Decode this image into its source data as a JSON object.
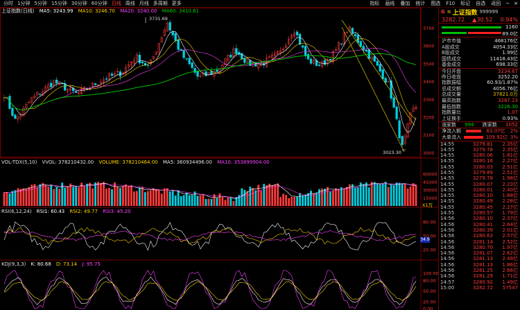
{
  "toolbar": {
    "periods": [
      "分时",
      "1分钟",
      "5分钟",
      "15分钟",
      "30分钟",
      "60分钟",
      "日线",
      "周线",
      "月线",
      "多周期",
      "更多"
    ],
    "active_period": "日线",
    "tools": [
      "指标",
      "画线",
      "叠加",
      "统计",
      "图选",
      "F10",
      "标记",
      "自选",
      "返回"
    ]
  },
  "main_chart": {
    "title": "上证指数(日线)",
    "ma5": "MA5: 3243.99",
    "ma10": "MA10: 3246.70",
    "ma20": "MA20: 3240.00",
    "ma60": "MA60: 3410.61",
    "high_label": "3731.69",
    "low_label": "3023.30",
    "price_axis": [
      "3700",
      "3600",
      "3500",
      "3400",
      "3300",
      "3200",
      "3100",
      "3000"
    ]
  },
  "volume_chart": {
    "title": "VOL-TDX(5,10)",
    "vvol": "VVOL: 378210432.00",
    "volume": "VOLUME: 378210464.00",
    "ma5": "MA5: 360934496.00",
    "ma10": "MA10: 353899904.00",
    "axis": [
      "60000",
      "45000",
      "30000",
      "15000"
    ],
    "unit": "X1万"
  },
  "rsi_chart": {
    "title": "RSI(6,12,24)",
    "rsi1": "RSI1: 60.43",
    "rsi2": "RSI2: 49.77",
    "rsi3": "RSI3: 45.20",
    "axis": [
      "80.00",
      "50.00",
      "20.00"
    ],
    "marker": "34.9"
  },
  "kdj_chart": {
    "title": "KDJ(9,3,3)",
    "k": "K: 80.68",
    "d": "D: 73.14",
    "j": "J: 95.75",
    "axis": [
      "100.00",
      "80.00",
      "50.00",
      "20.00",
      "0.00"
    ]
  },
  "quote": {
    "name": "上证指数",
    "code": "999999",
    "badge": "G",
    "price": "3282.72",
    "change": "▲30.52",
    "change_pct": "0.94%",
    "bar_up": "1160",
    "bar_down": "89.0亿",
    "stats": [
      {
        "label": "沪市市值",
        "value": "468176亿",
        "color": "#e0e0e0"
      },
      {
        "label": "A股成交",
        "value": "4054.33亿",
        "color": "#e0e0e0"
      },
      {
        "label": "B股成交",
        "value": "1.99亿",
        "color": "#e0e0e0"
      },
      {
        "label": "国债成交",
        "value": "11418.43亿",
        "color": "#e0e0e0"
      },
      {
        "label": "基金成交",
        "value": "698.33亿",
        "color": "#e0e0e0"
      },
      {
        "label": "今日开盘",
        "value": "3234.67",
        "color": "#ff3b3b"
      },
      {
        "label": "昨日收盘",
        "value": "3252.20",
        "color": "#e0e0e0"
      },
      {
        "label": "指数振幅",
        "value": "60.93/1.87%",
        "color": "#e0e0e0"
      },
      {
        "label": "总成交额",
        "value": "4056.76亿",
        "color": "#e0e0e0"
      },
      {
        "label": "总成交量",
        "value": "37821.0万",
        "color": "#e8c000"
      },
      {
        "label": "最高指数",
        "value": "3287.23",
        "color": "#ff3b3b"
      },
      {
        "label": "最低指数",
        "value": "3226.30",
        "color": "#00d000"
      },
      {
        "label": "指数量比",
        "value": "1.07",
        "color": "#ff3b3b"
      },
      {
        "label": "上证换手",
        "value": "0.93%",
        "color": "#e0e0e0"
      }
    ],
    "updown": {
      "up_label": "涨家数",
      "up_value": "1052",
      "down_label": "跌家数",
      "down_value": "994"
    },
    "flows": [
      {
        "label": "净流入额",
        "value": "63.07亿",
        "pct": "2%"
      },
      {
        "label": "大单流入",
        "value": "109.92亿",
        "pct": "3%"
      }
    ],
    "ticks": [
      {
        "time": "14:55",
        "price": "3279.81",
        "vol": "2.35亿"
      },
      {
        "time": "14:55",
        "price": "3279.78",
        "vol": "2.35亿"
      },
      {
        "time": "14:55",
        "price": "3280.06",
        "vol": "1.81亿"
      },
      {
        "time": "14:55",
        "price": "3280.16",
        "vol": "2.27亿"
      },
      {
        "time": "14:55",
        "price": "3280.03",
        "vol": "2.51亿"
      },
      {
        "time": "14:55",
        "price": "3279.89",
        "vol": "2.51亿"
      },
      {
        "time": "14:55",
        "price": "3279.78",
        "vol": "1.98亿"
      },
      {
        "time": "14:55",
        "price": "3280.07",
        "vol": "2.23亿"
      },
      {
        "time": "14:55",
        "price": "3280.01",
        "vol": "2.40亿"
      },
      {
        "time": "14:55",
        "price": "3280.10",
        "vol": "1.88亿"
      },
      {
        "time": "14:55",
        "price": "3280.49",
        "vol": "2.28亿"
      },
      {
        "time": "14:55",
        "price": "3280.45",
        "vol": "2.27亿"
      },
      {
        "time": "14:55",
        "price": "3280.57",
        "vol": "1.79亿"
      },
      {
        "time": "14:56",
        "price": "3280.10",
        "vol": "2.37亿"
      },
      {
        "time": "14:56",
        "price": "3280.41",
        "vol": "2.64亿"
      },
      {
        "time": "14:56",
        "price": "3280.39",
        "vol": "2.01亿"
      },
      {
        "time": "14:56",
        "price": "3280.63",
        "vol": "2.57亿"
      },
      {
        "time": "14:56",
        "price": "3281.14",
        "vol": "2.52亿"
      },
      {
        "time": "14:56",
        "price": "3280.70",
        "vol": "1.97亿"
      },
      {
        "time": "14:56",
        "price": "3281.07",
        "vol": "2.62亿"
      },
      {
        "time": "14:56",
        "price": "3281.13",
        "vol": "2.49亿"
      },
      {
        "time": "14:56",
        "price": "3281.13",
        "vol": "1.86亿"
      },
      {
        "time": "14:56",
        "price": "3281.25",
        "vol": "2.66亿"
      },
      {
        "time": "14:56",
        "price": "3281.29",
        "vol": "1.71亿"
      },
      {
        "time": "14:57",
        "price": "3280.92",
        "vol": "1.49亿"
      },
      {
        "time": "15:00",
        "price": "3282.72",
        "vol": "57547"
      }
    ]
  }
}
